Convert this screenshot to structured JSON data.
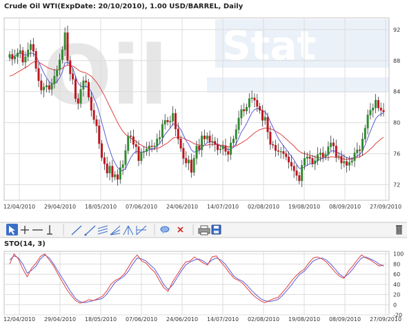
{
  "title": "Crude Oil WTI(ExpDate: 20/10/2010), 1.00 USD/BARREL, Daily",
  "watermark": {
    "left": "Oil",
    "right": "Stat"
  },
  "colors": {
    "up": "#2e8b2e",
    "down": "#c0141e",
    "ma_fast": "#5a5ad8",
    "ma_slow": "#e04040",
    "sto_k": "#5a5ad8",
    "sto_d": "#e04040",
    "toolbar_active": "#3a6fc7"
  },
  "toolbar": {
    "icons": [
      "cursor-icon",
      "crosshair-icon",
      "horizontal-line-icon",
      "vertical-line-icon",
      "trend-line-icon",
      "ray-line-icon",
      "parallel-lines-icon",
      "fan-lines-icon",
      "pitchfork-icon",
      "channel-icon",
      "comment-icon",
      "delete-icon",
      "print-icon",
      "save-icon",
      "trash-icon"
    ]
  },
  "chart_data": [
    {
      "type": "candlestick",
      "title": "Crude Oil WTI(ExpDate: 20/10/2010), 1.00 USD/BARREL, Daily",
      "x_ticks": [
        "12/04/2010",
        "29/04/2010",
        "18/05/2010",
        "07/06/2010",
        "24/06/2010",
        "14/07/2010",
        "02/08/2010",
        "19/08/2010",
        "08/09/2010",
        "27/09/2010"
      ],
      "y_ticks": [
        72,
        76,
        80,
        84,
        88,
        92
      ],
      "ylim": [
        70,
        93.5
      ],
      "grid": true,
      "close": [
        88.8,
        88.2,
        88.5,
        89.0,
        89.3,
        87.8,
        88.5,
        89.4,
        90.1,
        89.2,
        87.0,
        85.4,
        84.2,
        84.6,
        84.8,
        84.3,
        85.0,
        86.0,
        86.8,
        88.1,
        89.4,
        91.6,
        88.0,
        86.3,
        85.6,
        83.1,
        82.5,
        84.3,
        85.4,
        85.2,
        83.3,
        81.6,
        80.4,
        79.6,
        77.3,
        75.5,
        74.7,
        73.5,
        74.4,
        73.0,
        73.3,
        72.7,
        74.2,
        74.6,
        76.4,
        78.3,
        78.2,
        77.2,
        76.9,
        75.1,
        76.2,
        76.3,
        76.6,
        77.0,
        76.9,
        77.0,
        77.9,
        78.1,
        79.8,
        80.3,
        80.1,
        80.2,
        81.2,
        79.2,
        77.9,
        76.7,
        75.4,
        74.8,
        75.2,
        73.6,
        75.4,
        77.0,
        76.5,
        78.3,
        77.9,
        78.3,
        77.5,
        77.6,
        77.2,
        76.5,
        76.6,
        77.0,
        76.3,
        75.9,
        77.4,
        77.9,
        79.1,
        80.6,
        81.7,
        81.5,
        82.0,
        83.1,
        83.2,
        82.9,
        82.1,
        81.6,
        80.3,
        80.7,
        78.8,
        77.2,
        77.1,
        76.4,
        76.3,
        76.3,
        76.0,
        75.6,
        74.9,
        74.4,
        73.8,
        73.2,
        72.5,
        74.5,
        75.4,
        75.6,
        75.4,
        74.7,
        75.1,
        75.9,
        76.1,
        75.6,
        75.9,
        76.9,
        77.4,
        77.0,
        75.6,
        75.7,
        74.8,
        75.0,
        74.5,
        74.9,
        75.1,
        76.1,
        76.5,
        76.4,
        77.9,
        79.3,
        81.0,
        81.6,
        81.9,
        82.9,
        81.9,
        81.6,
        81.4
      ],
      "ma_fast": [
        88.3,
        88.4,
        88.6,
        88.8,
        89.0,
        88.8,
        88.7,
        88.8,
        89.0,
        88.9,
        88.6,
        87.9,
        87.1,
        86.4,
        85.8,
        85.3,
        85.0,
        85.1,
        85.3,
        85.8,
        86.5,
        87.7,
        87.8,
        87.5,
        87.0,
        86.0,
        85.1,
        84.7,
        84.6,
        84.7,
        84.5,
        84.0,
        83.2,
        82.4,
        81.3,
        80.0,
        78.8,
        77.5,
        76.5,
        75.5,
        74.8,
        74.2,
        73.9,
        73.8,
        74.1,
        74.8,
        75.5,
        76.0,
        76.3,
        76.2,
        76.2,
        76.2,
        76.3,
        76.5,
        76.6,
        76.7,
        77.0,
        77.3,
        77.9,
        78.5,
        78.9,
        79.3,
        79.8,
        79.8,
        79.6,
        79.1,
        78.4,
        77.7,
        77.2,
        76.5,
        76.2,
        76.3,
        76.4,
        76.8,
        77.1,
        77.4,
        77.5,
        77.5,
        77.4,
        77.2,
        77.0,
        76.9,
        76.7,
        76.5,
        76.6,
        76.8,
        77.3,
        78.0,
        78.8,
        79.3,
        79.9,
        80.6,
        81.3,
        81.7,
        81.8,
        81.8,
        81.5,
        81.4,
        80.9,
        80.1,
        79.4,
        78.7,
        78.0,
        77.5,
        77.0,
        76.6,
        76.1,
        75.7,
        75.2,
        74.6,
        74.1,
        74.1,
        74.3,
        74.5,
        74.7,
        74.7,
        74.8,
        75.1,
        75.3,
        75.4,
        75.6,
        75.9,
        76.3,
        76.4,
        76.2,
        76.1,
        75.9,
        75.7,
        75.5,
        75.4,
        75.4,
        75.5,
        75.7,
        75.9,
        76.4,
        77.1,
        78.0,
        78.9,
        79.7,
        80.5,
        80.9,
        81.1,
        81.3
      ],
      "ma_slow": [
        86.0,
        86.1,
        86.3,
        86.5,
        86.7,
        86.9,
        87.1,
        87.3,
        87.6,
        87.8,
        87.9,
        87.8,
        87.6,
        87.4,
        87.2,
        87.0,
        86.9,
        86.8,
        86.8,
        86.9,
        87.0,
        87.3,
        87.4,
        87.4,
        87.3,
        87.1,
        86.8,
        86.6,
        86.5,
        86.4,
        86.2,
        86.0,
        85.6,
        85.2,
        84.7,
        84.1,
        83.5,
        82.8,
        82.1,
        81.4,
        80.7,
        80.0,
        79.4,
        78.9,
        78.5,
        78.2,
        78.0,
        77.8,
        77.6,
        77.3,
        77.1,
        76.9,
        76.8,
        76.7,
        76.6,
        76.6,
        76.7,
        76.8,
        77.0,
        77.2,
        77.4,
        77.7,
        78.0,
        78.1,
        78.1,
        78.1,
        78.0,
        77.8,
        77.7,
        77.5,
        77.3,
        77.2,
        77.1,
        77.1,
        77.1,
        77.1,
        77.2,
        77.2,
        77.2,
        77.2,
        77.1,
        77.1,
        77.0,
        76.9,
        76.9,
        76.9,
        77.0,
        77.2,
        77.4,
        77.6,
        77.8,
        78.1,
        78.4,
        78.7,
        78.9,
        79.1,
        79.2,
        79.3,
        79.3,
        79.2,
        79.1,
        78.9,
        78.7,
        78.5,
        78.2,
        77.9,
        77.6,
        77.3,
        77.0,
        76.6,
        76.3,
        76.1,
        76.0,
        75.9,
        75.8,
        75.7,
        75.6,
        75.5,
        75.5,
        75.5,
        75.5,
        75.5,
        75.6,
        75.6,
        75.5,
        75.5,
        75.4,
        75.3,
        75.3,
        75.3,
        75.3,
        75.4,
        75.5,
        75.6,
        75.8,
        76.0,
        76.3,
        76.6,
        76.9,
        77.3,
        77.6,
        77.9,
        78.1
      ]
    },
    {
      "type": "line",
      "title": "STO(14, 3)",
      "x_ticks": [
        "12/04/2010",
        "29/04/2010",
        "18/05/2010",
        "07/06/2010",
        "24/06/2010",
        "14/07/2010",
        "02/08/2010",
        "19/08/2010",
        "08/09/2010",
        "27/09/2010"
      ],
      "y_ticks": [
        -20,
        0,
        20,
        40,
        60,
        80,
        100
      ],
      "ylim": [
        -20,
        105
      ],
      "grid": true,
      "series": [
        {
          "key": "k",
          "values": [
            88,
            96,
            92,
            80,
            62,
            68,
            76,
            90,
            98,
            92,
            80,
            66,
            52,
            38,
            24,
            12,
            6,
            4,
            6,
            8,
            10,
            12,
            20,
            32,
            44,
            50,
            56,
            66,
            80,
            92,
            90,
            86,
            78,
            70,
            56,
            40,
            30,
            38,
            52,
            66,
            78,
            84,
            88,
            90,
            86,
            80,
            88,
            92,
            88,
            80,
            68,
            56,
            50,
            46,
            38,
            28,
            20,
            12,
            8,
            6,
            8,
            10,
            18,
            28,
            38,
            50,
            60,
            66,
            76,
            86,
            90,
            92,
            88,
            80,
            70,
            60,
            54,
            60,
            70,
            82,
            92,
            94,
            90,
            86,
            80,
            76
          ]
        },
        {
          "key": "d",
          "values": [
            80,
            100,
            90,
            70,
            55,
            72,
            82,
            95,
            100,
            88,
            76,
            60,
            45,
            30,
            18,
            8,
            3,
            6,
            10,
            8,
            12,
            16,
            26,
            40,
            48,
            52,
            60,
            74,
            88,
            98,
            86,
            82,
            72,
            64,
            48,
            34,
            26,
            44,
            58,
            72,
            84,
            86,
            94,
            88,
            82,
            78,
            94,
            96,
            84,
            74,
            62,
            52,
            48,
            42,
            32,
            22,
            14,
            8,
            4,
            8,
            12,
            14,
            24,
            34,
            46,
            56,
            64,
            70,
            82,
            92,
            94,
            90,
            84,
            74,
            64,
            56,
            52,
            66,
            76,
            88,
            98,
            92,
            88,
            82,
            76,
            78
          ]
        }
      ]
    }
  ]
}
